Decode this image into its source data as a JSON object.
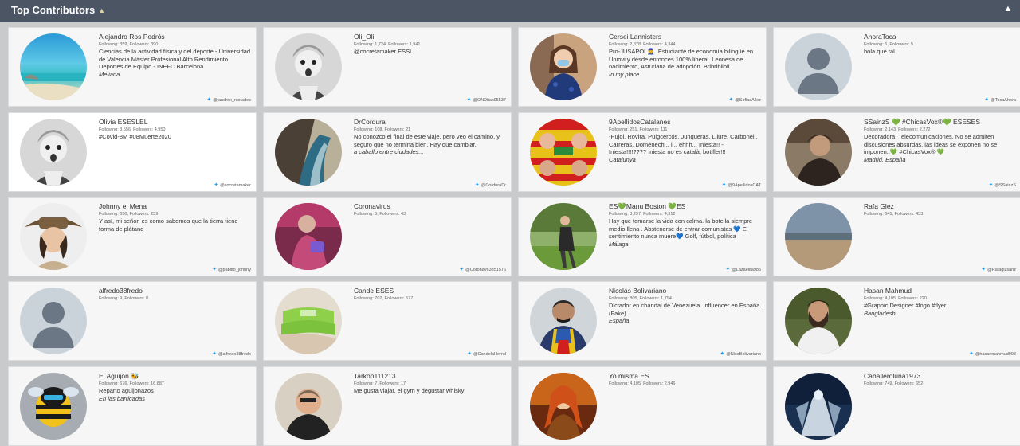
{
  "header": {
    "title": "Top Contributors",
    "download_icon": "download-icon",
    "collapse_icon": "chevron-up-icon"
  },
  "colors": {
    "header_bg": "#4b5563",
    "twitter": "#1da1f2",
    "card_bg": "#f6f6f6"
  },
  "cards": [
    {
      "name": "Alejandro Ros Pedrós",
      "stats": "Following: 359, Followers: 390",
      "bio": "Ciencias de la actividad física y del deporte - Universidad de Valencia Máster Profesional Alto Rendimiento Deportes de Equipo - INEFC Barcelona",
      "location": "Meliana",
      "handle": "@jandrox_rosfades"
    },
    {
      "name": "Oli_Oli",
      "stats": "Following: 1,724, Followers: 1,941",
      "bio": "@cocretamaker ESSL",
      "location": "",
      "handle": "@ONDitas95537"
    },
    {
      "name": "Cersei Lannisters",
      "stats": "Following: 2,878, Followers: 4,344",
      "bio": "Pro-JUSAPOL👮. Estudiante de economía bilingüe en Uniovi y desde entonces 100% liberal. Leonesa de nacimiento, Asturiana de adopción. Bribriblibli.",
      "location": "In my place.",
      "handle": "@SofiasAllez"
    },
    {
      "name": "AhoraToca",
      "stats": "Following: 6, Followers: 5",
      "bio": "hola qué tal",
      "location": "",
      "handle": "@TocaAhora"
    },
    {
      "name": "Olivia ESESLEL",
      "stats": "Following: 3,556, Followers: 4,950",
      "bio": "#Covid-8M #08Muerte2020",
      "location": "",
      "handle": "@cocretamaker"
    },
    {
      "name": "DrCordura",
      "stats": "Following: 108, Followers: 21",
      "bio": "No conozco el final de este viaje, pero veo el camino, y seguro que no termina bien. Hay que cambiar.",
      "location": "a caballo entre ciudades...",
      "handle": "@CorduraDr"
    },
    {
      "name": "9ApellidosCatalanes",
      "stats": "Following: 251, Followers: 111",
      "bio": "-Pujol, Rovira, Puigcercós, Junqueras, Lliure, Carbonell, Carreras, Domènech... i... ehhh... Iniesta!! - Iniesta!!!!???? Iniesta no es català, botifler!!!",
      "location": "Catalunya",
      "handle": "@9ApellidosCAT"
    },
    {
      "name": "SSainzS 💚 #ChicasVox®💚 ESESES",
      "stats": "Following: 2,143, Followers: 2,272",
      "bio": "Decoradora, Telecomunicaciones. No se admiten discusiones absurdas, las ideas se exponen no se imponen..💚 #ChicasVox® 💚",
      "location": "Madrid, España",
      "handle": "@SSainzS"
    },
    {
      "name": "Johnny el Mena",
      "stats": "Following: 650, Followers: 239",
      "bio": "Y así, mi señor, es como sabemos que la tierra tiene forma de plátano",
      "location": "",
      "handle": "@pablito_johnny"
    },
    {
      "name": "Coronavirus",
      "stats": "Following: 5, Followers: 43",
      "bio": "",
      "location": "",
      "handle": "@Coronav63851576"
    },
    {
      "name": "ES💚Manu Boston 💚ES",
      "stats": "Following: 3,297, Followers: 4,312",
      "bio": "Hay que tomarse la vida con calma. la botella siempre medio llena . Abstenerse de entrar comunistas 💙 El sentimiento nunca muere💙 Golf, fútbol, política",
      "location": "Málaga",
      "handle": "@Lazaelita985"
    },
    {
      "name": "Rafa Glez",
      "stats": "Following: 645, Followers: 433",
      "bio": "",
      "location": "",
      "handle": "@Rafaglzsanz"
    },
    {
      "name": "alfredo38fredo",
      "stats": "Following: 9, Followers: 8",
      "bio": "",
      "location": "",
      "handle": "@alfredo38fredo"
    },
    {
      "name": "Cande ESES",
      "stats": "Following: 702, Followers: 577",
      "bio": "",
      "location": "",
      "handle": "@CandelaHernd"
    },
    {
      "name": "Nicolás Bolivariano",
      "stats": "Following: 805, Followers: 1,794",
      "bio": "Dictador en chándal de Venezuela. Influencer en España. (Fake)",
      "location": "España",
      "handle": "@NicoBolivariano"
    },
    {
      "name": "Hasan Mahmud",
      "stats": "Following: 4,105, Followers: 220",
      "bio": "#Graphic Designer #logo #flyer",
      "location": "Bangladesh",
      "handle": "@hasanmahmud998"
    },
    {
      "name": "El Aguijón 🐝",
      "stats": "Following: 676, Followers: 16,887",
      "bio": "Reparto aguijonazos",
      "location": "En las barricadas",
      "handle": ""
    },
    {
      "name": "Tarkon111213",
      "stats": "Following: 7, Followers: 17",
      "bio": "Me gusta viajar, el gym y degustar whisky",
      "location": "",
      "handle": ""
    },
    {
      "name": "Yo misma ES",
      "stats": "Following: 4,105, Followers: 2,946",
      "bio": "",
      "location": "",
      "handle": ""
    },
    {
      "name": "Caballeroluna1973",
      "stats": "Following: 749, Followers: 652",
      "bio": "",
      "location": "",
      "handle": ""
    }
  ]
}
